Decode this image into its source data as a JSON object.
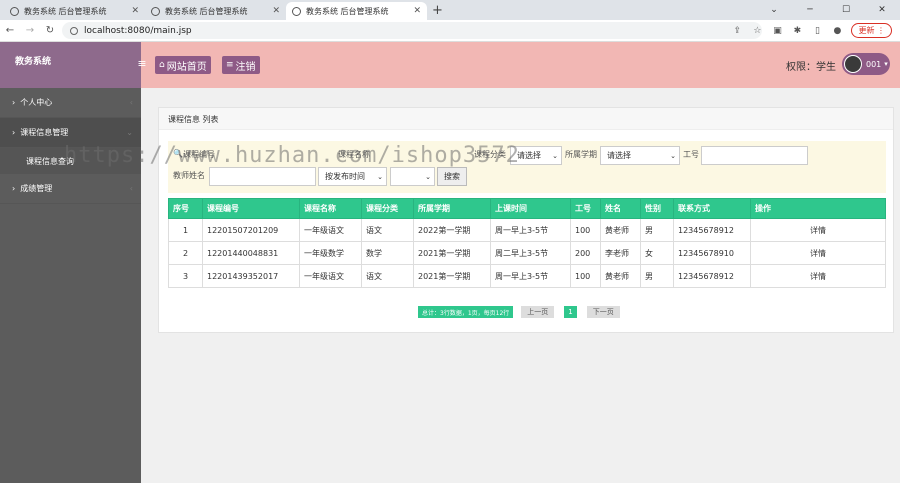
{
  "browser": {
    "tabs": [
      {
        "title": "教务系统 后台管理系统",
        "active": false
      },
      {
        "title": "教务系统 后台管理系统",
        "active": false
      },
      {
        "title": "教务系统 后台管理系统",
        "active": true
      }
    ],
    "new_tab_icon": "plus-icon",
    "url": "localhost:8080/main.jsp",
    "update_label": "更新"
  },
  "sidebar": {
    "title": "教务系统",
    "items": [
      {
        "label": "个人中心"
      },
      {
        "label": "课程信息管理"
      },
      {
        "label": "成绩管理"
      }
    ],
    "subitems": [
      {
        "label": "课程信息查询"
      }
    ]
  },
  "topbar": {
    "home_label": "网站首页",
    "logout_label": "注销",
    "permission": "权限：学生",
    "username": "001"
  },
  "panel": {
    "title": "课程信息 列表"
  },
  "filter": {
    "course_no_label": "课程编号",
    "course_name_label": "课程名称",
    "course_type_label": "课程分类",
    "course_type_value": "请选择",
    "semester_label": "所属学期",
    "semester_value": "请选择",
    "job_no_label": "工号",
    "teacher_label": "教师姓名",
    "sort_value": "按发布时间",
    "order_value": "",
    "search_label": "搜索"
  },
  "table": {
    "headers": [
      "序号",
      "课程编号",
      "课程名称",
      "课程分类",
      "所属学期",
      "上课时间",
      "工号",
      "姓名",
      "性别",
      "联系方式",
      "操作"
    ],
    "rows": [
      [
        "1",
        "12201507201209",
        "一年级语文",
        "语文",
        "2022第一学期",
        "周一早上3-5节",
        "100",
        "黄老师",
        "男",
        "12345678912",
        "详情"
      ],
      [
        "2",
        "12201440048831",
        "一年级数学",
        "数学",
        "2021第一学期",
        "周二早上3-5节",
        "200",
        "李老师",
        "女",
        "12345678910",
        "详情"
      ],
      [
        "3",
        "12201439352017",
        "一年级语文",
        "语文",
        "2021第一学期",
        "周一早上3-5节",
        "100",
        "黄老师",
        "男",
        "12345678912",
        "详情"
      ]
    ]
  },
  "pager": {
    "total": "总计：3行数据，1页，每页12行",
    "prev": "上一页",
    "current": "1",
    "next": "下一页"
  },
  "watermark": "https://www.huzhan.com/ishop3572",
  "colors": {
    "sidebar_head": "#8e6a8c",
    "sidebar": "#5c5c5c",
    "topbar": "#f2b7b4",
    "accent_button": "#8e5a86",
    "table_header": "#2fc78d",
    "filter_bg": "#fcf8e3"
  }
}
